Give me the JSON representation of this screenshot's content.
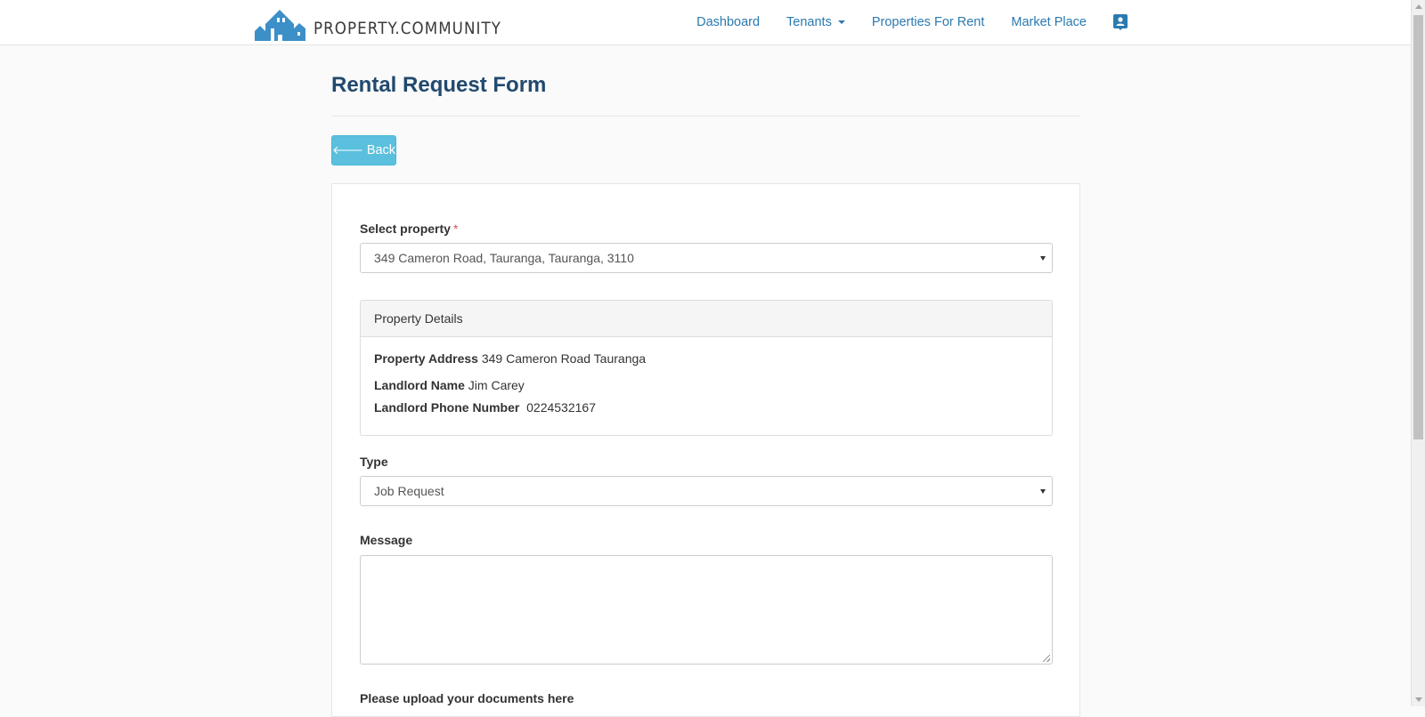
{
  "brand": {
    "name": "PROPERTY.COMMUNITY",
    "logo_color": "#3d8fc8"
  },
  "nav": {
    "items": [
      {
        "label": "Dashboard"
      },
      {
        "label": "Tenants",
        "has_dropdown": true
      },
      {
        "label": "Properties For Rent"
      },
      {
        "label": "Market Place"
      }
    ],
    "profile_icon": "contact-card-icon",
    "link_color": "#2a7ab0"
  },
  "page": {
    "title": "Rental Request Form",
    "back_label": "Back",
    "back_icon": "arrow-left-icon",
    "back_color": "#5bc0de"
  },
  "form": {
    "property": {
      "label": "Select property",
      "required_mark": "*",
      "value": "349 Cameron Road, Tauranga, Tauranga, 3110"
    },
    "details": {
      "heading": "Property Details",
      "address_label": "Property Address",
      "address_value": "349 Cameron Road Tauranga",
      "landlord_name_label": "Landlord Name",
      "landlord_name_value": "Jim Carey",
      "landlord_phone_label": "Landlord Phone Number",
      "landlord_phone_value": "0224532167"
    },
    "type": {
      "label": "Type",
      "value": "Job Request"
    },
    "message": {
      "label": "Message",
      "value": ""
    },
    "upload": {
      "label": "Please upload your documents here"
    }
  }
}
